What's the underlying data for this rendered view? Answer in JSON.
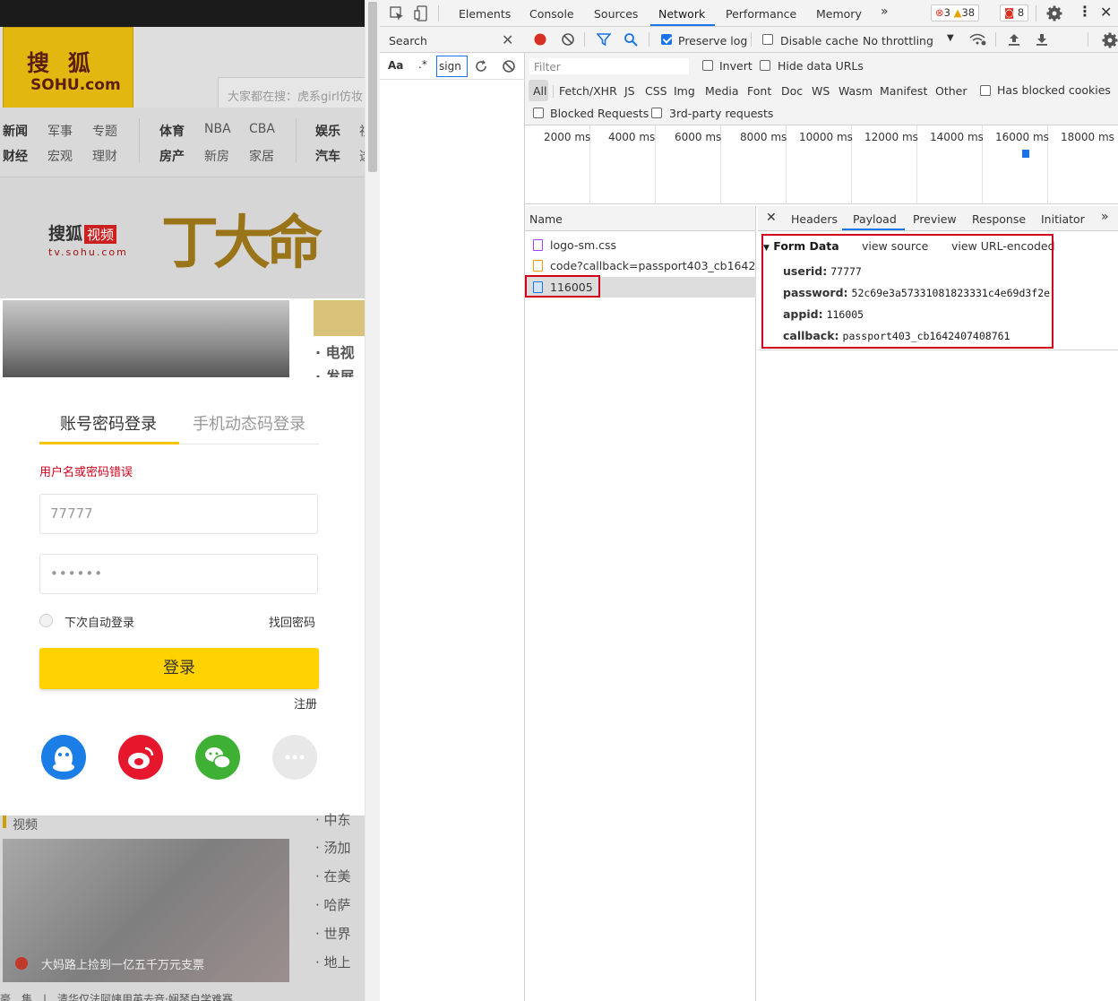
{
  "sohu": {
    "logo_top": "搜 狐",
    "logo_bottom": "SOHU.com",
    "search_placeholder": "大家都在搜：虎系girl仿妆",
    "nav_rows": [
      [
        "新闻",
        "军事",
        "专题",
        "体育",
        "NBA",
        "CBA",
        "娱乐",
        "视"
      ],
      [
        "财经",
        "宏观",
        "理财",
        "房产",
        "新房",
        "家居",
        "汽车",
        "选"
      ]
    ],
    "tv_logo": "搜狐",
    "tv_badge": "视频",
    "tv_domain": "tv.sohu.com",
    "banner_art": "丁大命",
    "news_side": [
      "电视",
      "发展"
    ],
    "video_section": "视频",
    "below_caption": "大妈路上捡到一亿五千万元支票",
    "below_news": [
      "中东",
      "汤加",
      "在美",
      "哈萨",
      "世界",
      "地上"
    ],
    "bottom_strip": "豪　集　|　清华仅法阿姨用英去音·娴琴自学难赛"
  },
  "login": {
    "tab_password": "账号密码登录",
    "tab_sms": "手机动态码登录",
    "error": "用户名或密码错误",
    "username_value": "77777",
    "password_value": "••••••",
    "auto_login": "下次自动登录",
    "forgot": "找回密码",
    "submit": "登录",
    "register": "注册",
    "social_icons": [
      "qq-icon",
      "weibo-icon",
      "wechat-icon",
      "more-icon"
    ],
    "colors": {
      "qq": "#1a7ee6",
      "weibo": "#e6162d",
      "wechat": "#3eb135",
      "more": "#e8e8e8",
      "submit": "#ffd200"
    }
  },
  "devtools": {
    "tabs": [
      "Elements",
      "Console",
      "Sources",
      "Network",
      "Performance",
      "Memory"
    ],
    "active_tab": "Network",
    "badges": {
      "errors": "3",
      "warnings": "38",
      "issues": "8"
    },
    "search": {
      "title": "Search",
      "aa": "Aa",
      "regex": ".*",
      "query": "sign"
    },
    "toolbar": {
      "preserve_log": "Preserve log",
      "disable_cache": "Disable cache",
      "throttling": "No throttling"
    },
    "filter": {
      "placeholder": "Filter",
      "invert": "Invert",
      "hide_data_urls": "Hide data URLs",
      "types": [
        "All",
        "Fetch/XHR",
        "JS",
        "CSS",
        "Img",
        "Media",
        "Font",
        "Doc",
        "WS",
        "Wasm",
        "Manifest",
        "Other"
      ],
      "has_blocked_cookies": "Has blocked cookies",
      "blocked_requests": "Blocked Requests",
      "third_party": "3rd-party requests"
    },
    "timeline_labels": [
      "2000 ms",
      "4000 ms",
      "6000 ms",
      "8000 ms",
      "10000 ms",
      "12000 ms",
      "14000 ms",
      "16000 ms",
      "18000 ms"
    ],
    "name_header": "Name",
    "requests": [
      {
        "name": "logo-sm.css",
        "type": "css"
      },
      {
        "name": "code?callback=passport403_cb1642...",
        "type": "js"
      },
      {
        "name": "116005",
        "type": "doc"
      }
    ],
    "detail_tabs": [
      "Headers",
      "Payload",
      "Preview",
      "Response",
      "Initiator"
    ],
    "active_detail_tab": "Payload",
    "form_data": {
      "title": "Form Data",
      "view_source": "view source",
      "view_url_encoded": "view URL-encoded",
      "fields": [
        {
          "key": "userid:",
          "value": "77777"
        },
        {
          "key": "password:",
          "value": "52c69e3a57331081823331c4e69d3f2e"
        },
        {
          "key": "appid:",
          "value": "116005"
        },
        {
          "key": "callback:",
          "value": "passport403_cb1642407408761"
        }
      ]
    }
  }
}
